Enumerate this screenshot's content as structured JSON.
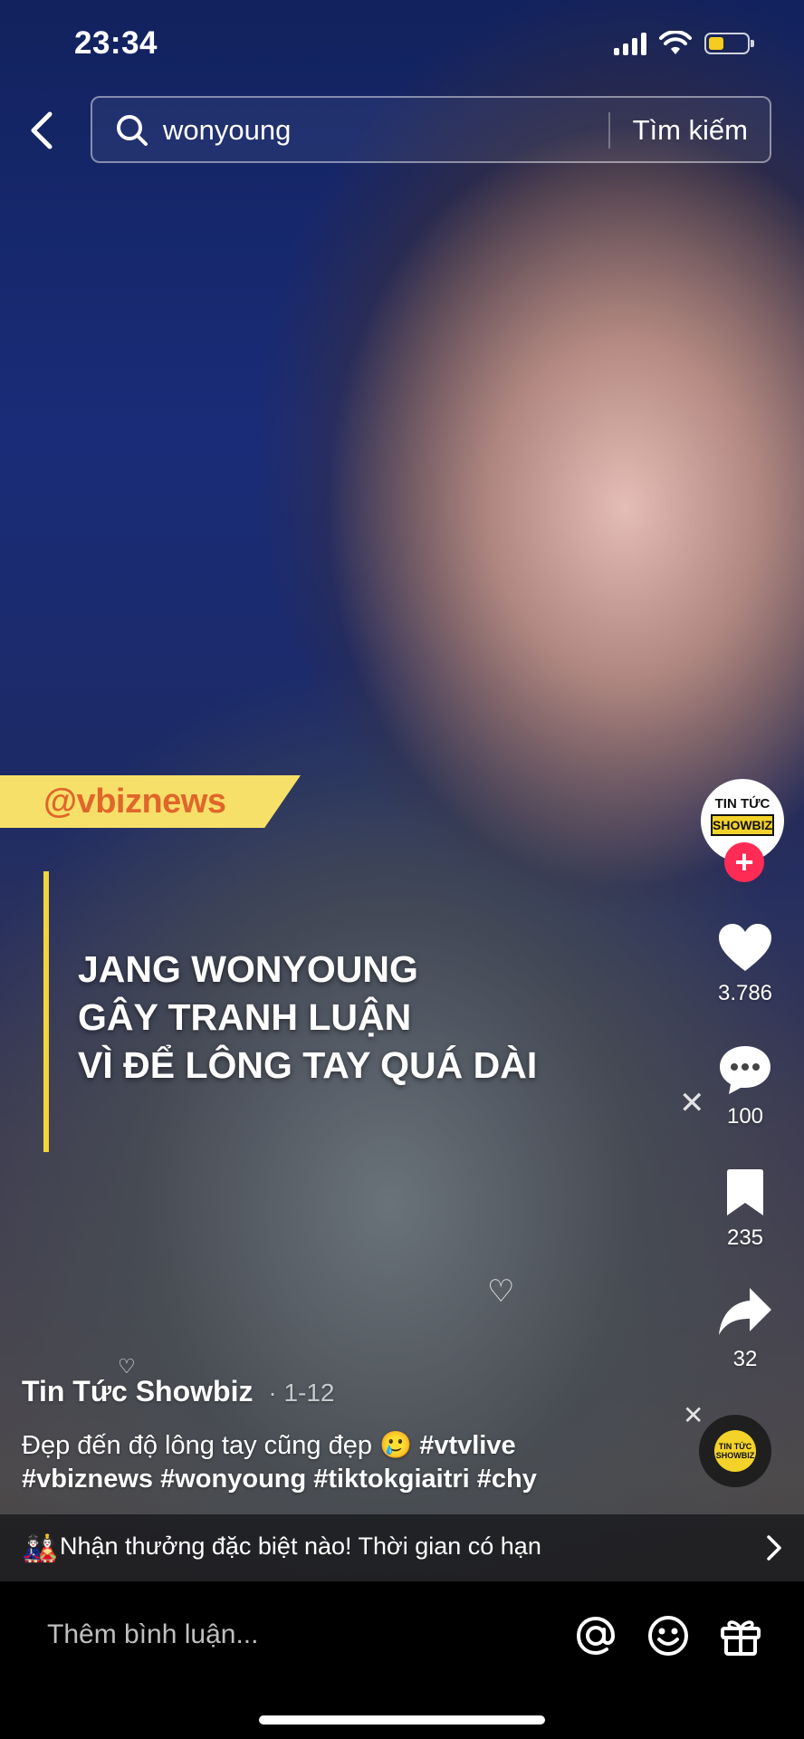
{
  "status_bar": {
    "time": "23:34",
    "battery_level": 0.4
  },
  "search": {
    "query": "wonyoung",
    "submit_label": "Tìm kiếm"
  },
  "video": {
    "watermark": "@vbiznews",
    "overlay_title_lines": [
      "JANG WONYOUNG",
      "GÂY TRANH LUẬN",
      "VÌ ĐỂ LÔNG TAY QUÁ DÀI"
    ]
  },
  "creator_avatar": {
    "line1": "TIN TỨC",
    "line2": "SHOWBIZ",
    "follow_symbol": "+"
  },
  "actions": {
    "likes": "3.786",
    "comments": "100",
    "saves": "235",
    "shares": "32"
  },
  "music_disc": {
    "line1": "TIN TỨC",
    "line2": "SHOWBIZ"
  },
  "post": {
    "author": "Tin Tức Showbiz",
    "date": "· 1-12",
    "caption_text": "Đẹp đến độ lông tay cũng đẹp 🥲",
    "caption_tag1": "#vtvlive",
    "caption_tags2": "#vbiznews #wonyoung #tiktokgiaitri #chy"
  },
  "promo": {
    "icon": "🎎",
    "text": "Nhận thưởng đặc biệt nào! Thời gian có hạn"
  },
  "comment_bar": {
    "placeholder": "Thêm bình luận..."
  },
  "colors": {
    "accent_red": "#fe2c55",
    "watermark_yellow": "#f7e06a",
    "watermark_text": "#e0662a",
    "overlay_bar": "#f2d43c"
  },
  "icons": [
    "back-arrow-icon",
    "search-icon",
    "heart-icon",
    "comment-icon",
    "bookmark-icon",
    "share-icon",
    "chevron-right-icon",
    "mention-icon",
    "emoji-icon",
    "gift-icon"
  ]
}
